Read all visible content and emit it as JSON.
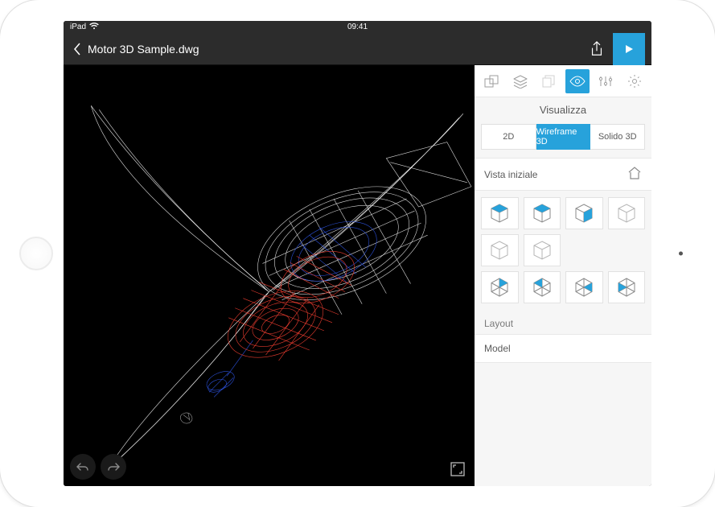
{
  "status": {
    "device": "iPad",
    "time": "09:41"
  },
  "header": {
    "filename": "Motor 3D Sample.dwg"
  },
  "panel": {
    "title": "Visualizza",
    "seg": {
      "opt2d": "2D",
      "optWire": "Wireframe 3D",
      "optSolid": "Solido 3D"
    },
    "initial_view": "Vista iniziale",
    "layout_label": "Layout",
    "model_label": "Model"
  }
}
